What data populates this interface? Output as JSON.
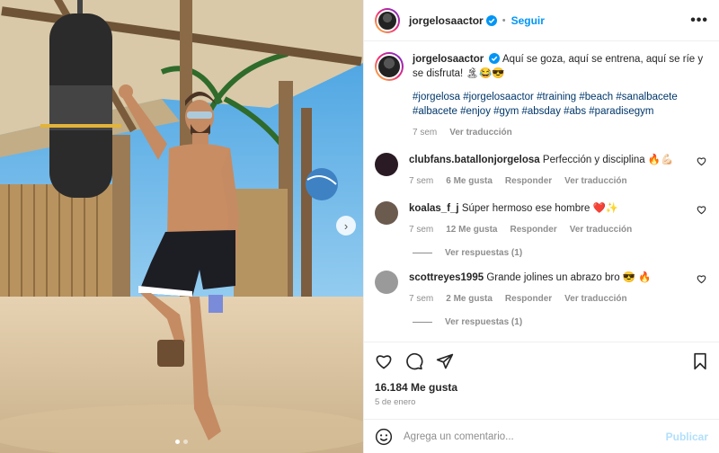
{
  "post": {
    "username": "jorgelosaactor",
    "follow_label": "Seguir",
    "more_label": "•••",
    "separator": "•"
  },
  "caption": {
    "username": "jorgelosaactor",
    "text": "Aquí se goza, aquí se entrena, aquí se ríe y se disfruta! 🏝😂😎",
    "hashtags": "#jorgelosa #jorgelosaactor #training #beach #sanalbacete #albacete #enjoy #gym #absday #abs #paradisegym",
    "time": "7 sem",
    "translate": "Ver traducción"
  },
  "comments": [
    {
      "username": "clubfans.batallonjorgelosa",
      "text": "Perfección y disciplina 🔥💪🏻",
      "time": "7 sem",
      "likes": "6 Me gusta",
      "reply": "Responder",
      "translate": "Ver traducción",
      "avatar_color": "#2a1a24"
    },
    {
      "username": "koalas_f_j",
      "text": "Súper hermoso ese hombre ❤️✨",
      "time": "7 sem",
      "likes": "12 Me gusta",
      "reply": "Responder",
      "translate": "Ver traducción",
      "replies": "Ver respuestas (1)",
      "avatar_color": "#6b5a4e"
    },
    {
      "username": "scottreyes1995",
      "text": "Grande jolines un abrazo bro 😎 🔥",
      "time": "7 sem",
      "likes": "2 Me gusta",
      "reply": "Responder",
      "translate": "Ver traducción",
      "replies": "Ver respuestas (1)",
      "avatar_color": "#9a9a9a"
    }
  ],
  "stats": {
    "likes": "16.184 Me gusta",
    "date": "5 de enero"
  },
  "add_comment": {
    "placeholder": "Agrega un comentario...",
    "publish": "Publicar"
  },
  "icons": [
    "verified-icon",
    "more-icon",
    "heart-icon",
    "comment-icon",
    "share-icon",
    "bookmark-icon",
    "emoji-icon",
    "chevron-right-icon"
  ],
  "colors": {
    "accent": "#0095f6",
    "hashtag": "#00376b",
    "muted": "#8e8e8e",
    "publish_disabled": "#b2dffc"
  }
}
